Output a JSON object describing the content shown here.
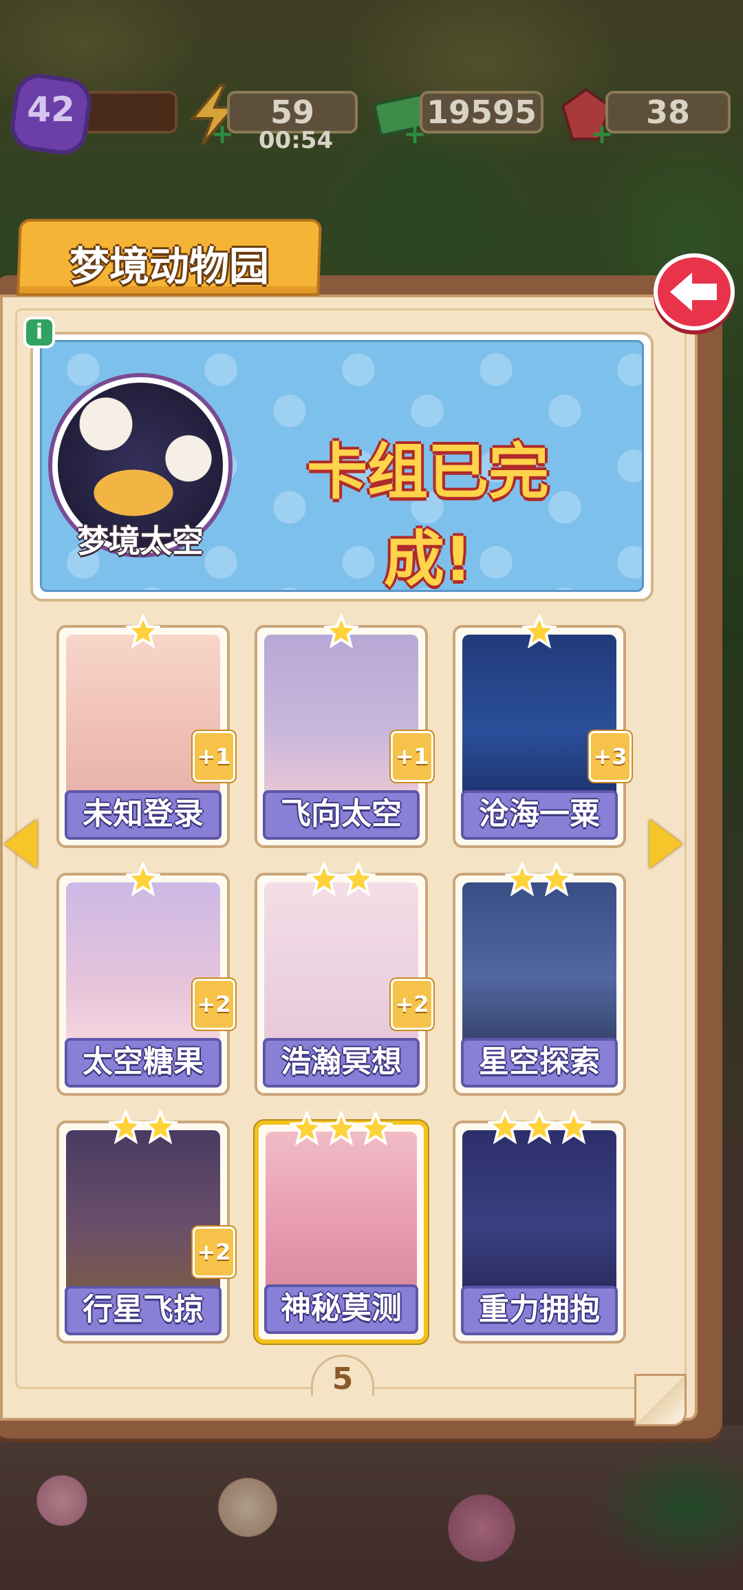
{
  "hud": {
    "level": "42",
    "energy": "59",
    "energy_timer": "00:54",
    "cash": "19595",
    "gems": "38"
  },
  "panel": {
    "title": "梦境动物园",
    "page_number": "5"
  },
  "deck": {
    "name": "梦境太空",
    "status": "卡组已完成!"
  },
  "cards": [
    {
      "label": "未知登录",
      "stars": 1,
      "badge": "+1",
      "selected": false
    },
    {
      "label": "飞向太空",
      "stars": 1,
      "badge": "+1",
      "selected": false
    },
    {
      "label": "沧海一粟",
      "stars": 1,
      "badge": "+3",
      "selected": false
    },
    {
      "label": "太空糖果",
      "stars": 1,
      "badge": "+2",
      "selected": false
    },
    {
      "label": "浩瀚冥想",
      "stars": 2,
      "badge": "+2",
      "selected": false
    },
    {
      "label": "星空探索",
      "stars": 2,
      "badge": "",
      "selected": false
    },
    {
      "label": "行星飞掠",
      "stars": 2,
      "badge": "+2",
      "selected": false
    },
    {
      "label": "神秘莫测",
      "stars": 3,
      "badge": "",
      "selected": true
    },
    {
      "label": "重力拥抱",
      "stars": 3,
      "badge": "",
      "selected": false
    }
  ],
  "icons": {
    "level": "star-badge-icon",
    "energy": "lightning-icon",
    "cash": "cash-icon",
    "gems": "gem-icon",
    "back": "back-arrow-icon",
    "info": "info-icon",
    "prev": "chevron-left-icon",
    "next": "chevron-right-icon"
  },
  "colors": {
    "panel_bg": "#f4e3c4",
    "title_tab": "#f6b436",
    "banner": "#7ec0ec",
    "label_bar": "#8a7fd6",
    "back_button": "#e8334a",
    "highlight": "#f4c21d"
  }
}
